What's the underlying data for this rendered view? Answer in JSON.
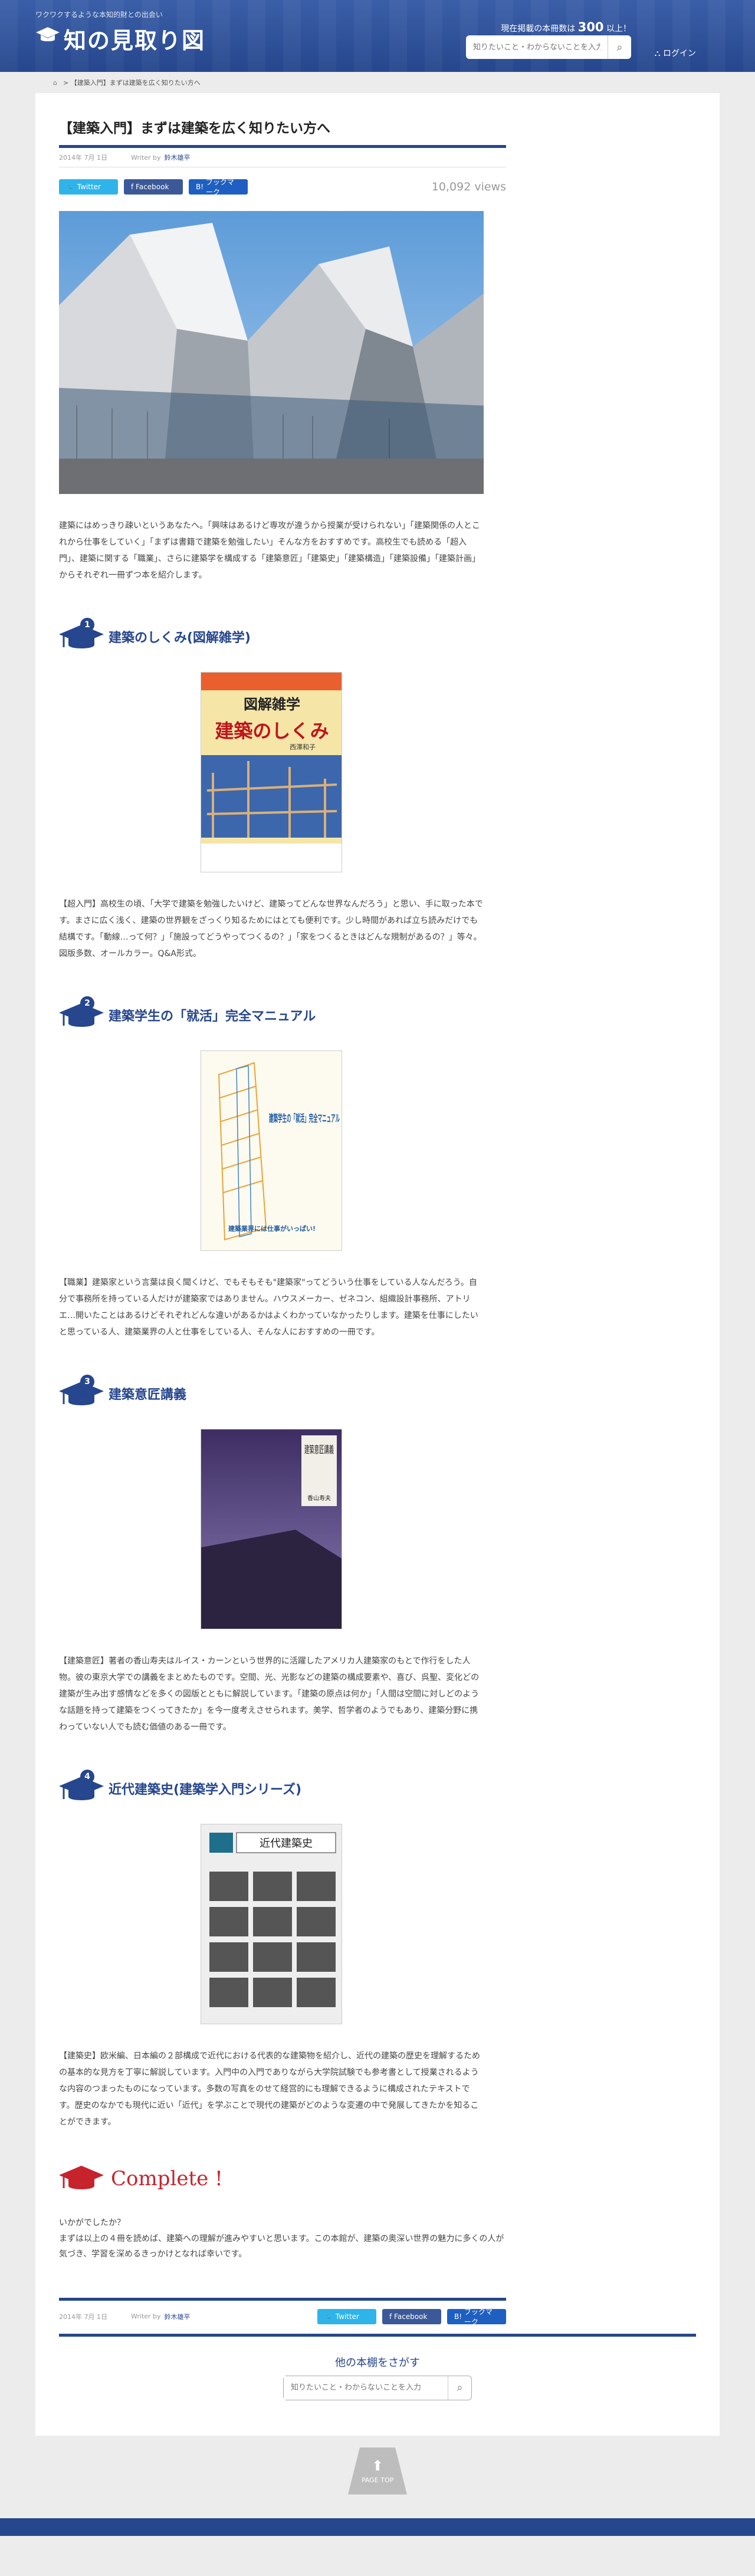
{
  "header": {
    "tagline": "ワクワクするような本知的財との出会い",
    "logo": "知の見取り図",
    "count_prefix": "現在掲載の本冊数は",
    "count_value": "300",
    "count_suffix": "以上！",
    "search_placeholder": "知りたいこと・わからないことを入力",
    "login": "ログイン"
  },
  "breadcrumb": {
    "home_icon": "home-icon",
    "current": "【建築入門】まずは建築を広く知りたい方へ"
  },
  "article": {
    "title": "【建築入門】まずは建築を広く知りたい方へ",
    "date": "2014年 7月 1日",
    "writer_label": "Writer by",
    "writer": "鈴木雄平",
    "share": {
      "twitter": "Twitter",
      "facebook": "Facebook",
      "hatena": "ブックマーク"
    },
    "views": "10,092 views",
    "lead": "建築にはめっきり疎いというあなたへ。「興味はあるけど専攻が違うから授業が受けられない」「建築関係の人とこれから仕事をしていく」「まずは書籍で建築を勉強したい」そんな方をおすすめです。高校生でも読める「超入門」、建築に関する「職業」、さらに建築学を構成する「建築意匠」「建築史」「建築構造」「建築設備」「建築計画」からそれぞれ一冊ずつ本を紹介します。"
  },
  "sections": [
    {
      "num": "1",
      "title": "建築のしくみ(図解雑学)",
      "desc": "【超入門】高校生の頃、「大学で建築を勉強したいけど、建築ってどんな世界なんだろう」と思い、手に取った本です。まさに広く浅く、建築の世界観をざっくり知るためにはとても便利です。少し時間があれば立ち読みだけでも結構です。「動線…って何？」「施設ってどうやってつくるの？」「家をつくるときはどんな規制があるの？」等々。図版多数、オールカラー。Q&A形式。",
      "cover": {
        "top": "図解雑学",
        "main": "建築のしくみ",
        "author": "西澤和子"
      }
    },
    {
      "num": "2",
      "title": "建築学生の「就活」完全マニュアル",
      "desc": "【職業】建築家という言葉は良く聞くけど、でもそもそも\"建築家\"ってどういう仕事をしている人なんだろう。自分で事務所を持っている人だけが建築家ではありません。ハウスメーカー、ゼネコン、組織設計事務所、アトリエ…開いたことはあるけどそれぞれどんな違いがあるかはよくわかっていなかったりします。建築を仕事にしたいと思っている人、建築業界の人と仕事をしている人、そんな人におすすめの一冊です。",
      "cover": {
        "main": "建築学生の「就活」完全マニュアル",
        "bottom": "建築業界には仕事がいっぱい!"
      }
    },
    {
      "num": "3",
      "title": "建築意匠講義",
      "desc": "【建築意匠】著者の香山寿夫はルイス・カーンという世界的に活躍したアメリカ人建築家のもとで作行をした人物。彼の東京大学での講義をまとめたものです。空間、光、光影などの建築の構成要素や、喜び、呉聖、変化どの建築が生み出す感情などを多くの図版とともに解説しています。「建築の原点は何か」「人間は空間に対しどのような話題を持って建築をつくってきたか」を今一度考えさせられます。美学、哲学者のようでもあり、建築分野に携わっていない人でも読む価値のある一冊です。",
      "cover": {
        "main": "建築意匠講義",
        "author": "香山寿夫"
      }
    },
    {
      "num": "4",
      "title": "近代建築史(建築学入門シリーズ)",
      "desc": "【建築史】欧米編、日本編の２部構成で近代における代表的な建築物を紹介し、近代の建築の歴史を理解するための基本的な見方を丁寧に解説しています。入門中の入門でありながら大学院試験でも参考書として授業されるような内容のつまったものになっています。多数の写真をのせて経営的にも理解できるように構成されたテキストです。歴史のなかでも現代に近い「近代」を学ぶことで現代の建築がどのような変遷の中で発展してきたかを知ることができます。",
      "cover": {
        "main": "近代建築史"
      }
    }
  ],
  "complete": {
    "label": "Complete !",
    "closing_1": "いかがでしたか？",
    "closing_2": "まずは以上の４冊を読めば、建築への理解が進みやすいと思います。この本館が、建築の奥深い世界の魅力に多くの人が気づき、学習を深めるきっかけとなれば幸いです。"
  },
  "footer": {
    "find_label": "他の本棚をさがす",
    "search_placeholder": "知りたいこと・わからないことを入力",
    "pagetop": "PAGE TOP"
  }
}
